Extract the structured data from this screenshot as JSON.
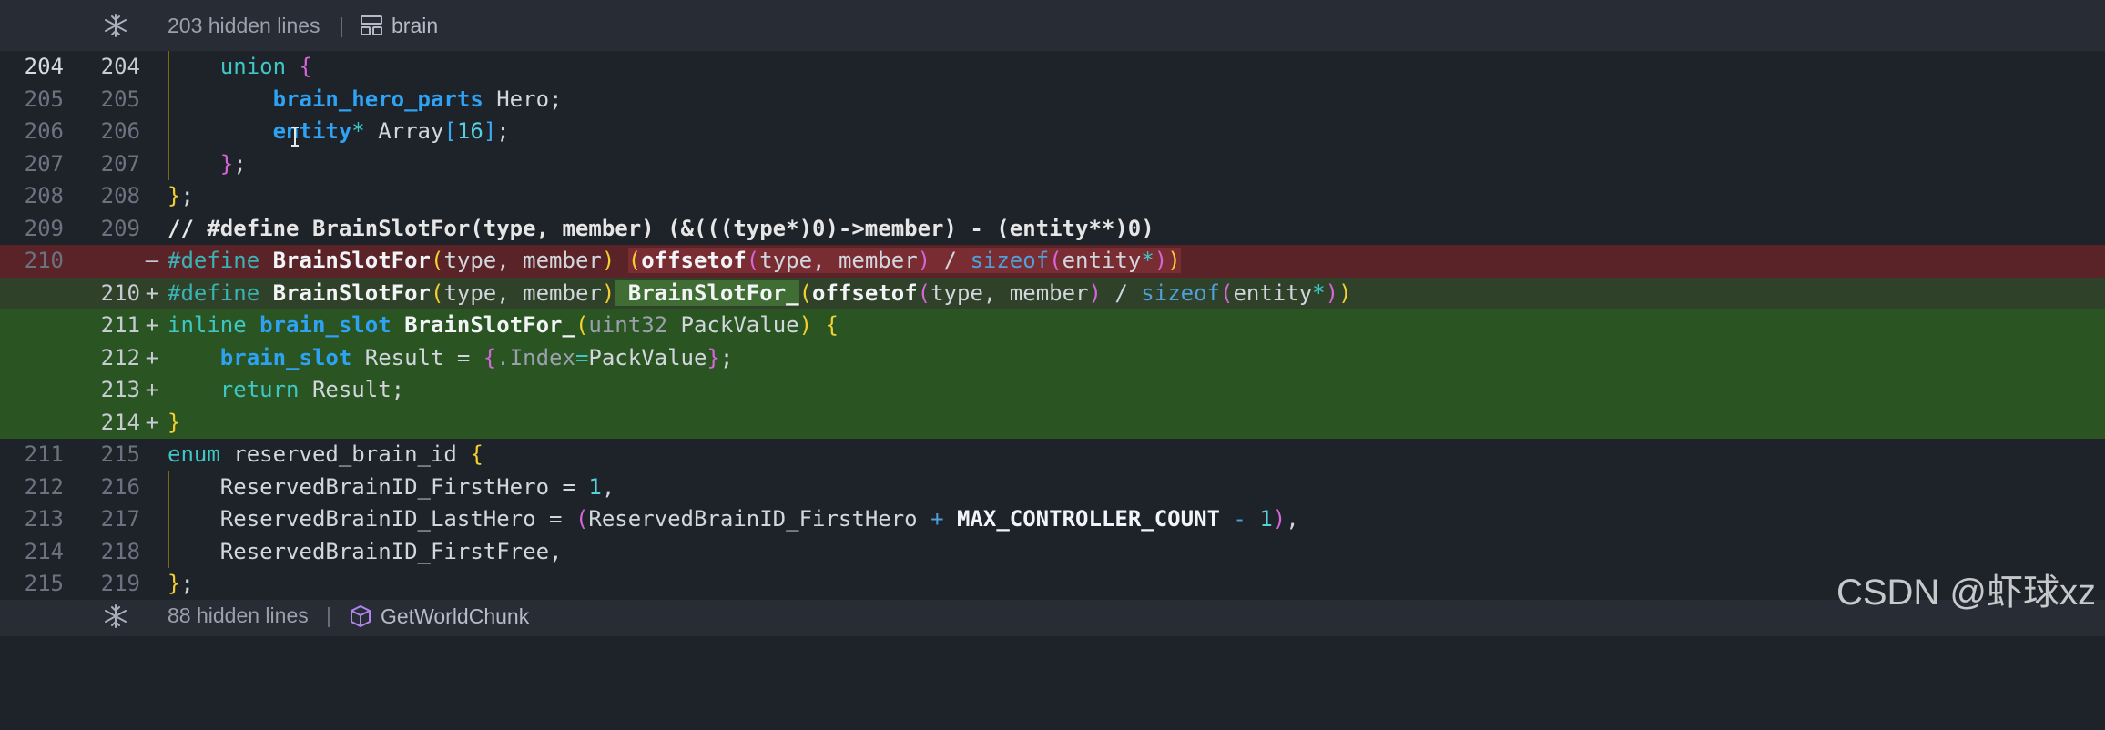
{
  "fold_top": {
    "text": "203 hidden lines",
    "sep": "|",
    "crumb": "brain"
  },
  "fold_bottom": {
    "text": "88 hidden lines",
    "sep": "|",
    "crumb": "GetWorldChunk"
  },
  "lines": [
    {
      "old": "204",
      "new": "204",
      "kind": "ctx",
      "cur": true
    },
    {
      "old": "205",
      "new": "205",
      "kind": "ctx"
    },
    {
      "old": "206",
      "new": "206",
      "kind": "ctx"
    },
    {
      "old": "207",
      "new": "207",
      "kind": "ctx"
    },
    {
      "old": "208",
      "new": "208",
      "kind": "ctx"
    },
    {
      "old": "209",
      "new": "209",
      "kind": "ctx"
    },
    {
      "old": "210",
      "new": "",
      "kind": "del",
      "mark": "—"
    },
    {
      "old": "",
      "new": "210",
      "kind": "mod",
      "mark": "+"
    },
    {
      "old": "",
      "new": "211",
      "kind": "ins",
      "mark": "+"
    },
    {
      "old": "",
      "new": "212",
      "kind": "ins",
      "mark": "+"
    },
    {
      "old": "",
      "new": "213",
      "kind": "ins",
      "mark": "+"
    },
    {
      "old": "",
      "new": "214",
      "kind": "ins",
      "mark": "+"
    },
    {
      "old": "211",
      "new": "215",
      "kind": "ctx"
    },
    {
      "old": "212",
      "new": "216",
      "kind": "ctx"
    },
    {
      "old": "213",
      "new": "217",
      "kind": "ctx"
    },
    {
      "old": "214",
      "new": "218",
      "kind": "ctx"
    },
    {
      "old": "215",
      "new": "219",
      "kind": "ctx"
    }
  ],
  "code": {
    "l0": [
      "    ",
      "union",
      " ",
      "{"
    ],
    "l1": [
      "        ",
      "brain_hero_parts",
      " Hero;"
    ],
    "l2": [
      "        ",
      "entity",
      "*",
      " Array",
      "[",
      "16",
      "]",
      ";"
    ],
    "l3": [
      "    ",
      "}",
      ";"
    ],
    "l4": [
      "}",
      ";"
    ],
    "l5": "// #define BrainSlotFor(type, member) (&(((type*)0)->member) - (entity**)0)",
    "l6": [
      "#define",
      " ",
      "BrainSlotFor",
      "(",
      "type, member",
      ")",
      " ",
      "(",
      "offsetof",
      "(",
      "type, member",
      ")",
      " / ",
      "sizeof",
      "(",
      "entity",
      "*",
      ")",
      ")"
    ],
    "l7": [
      "#define",
      " ",
      "BrainSlotFor",
      "(",
      "type, member",
      ")",
      " ",
      "BrainSlotFor_",
      "(",
      "offsetof",
      "(",
      "type, member",
      ")",
      " / ",
      "sizeof",
      "(",
      "entity",
      "*",
      ")",
      ")"
    ],
    "l8": [
      "inline",
      " ",
      "brain_slot",
      " ",
      "BrainSlotFor_",
      "(",
      "uint32",
      " PackValue",
      ")",
      " ",
      "{"
    ],
    "l9": [
      "    ",
      "brain_slot",
      " Result = ",
      "{",
      ".Index",
      "=",
      "PackValue",
      "}",
      ";"
    ],
    "l10": [
      "    ",
      "return",
      " Result;"
    ],
    "l11": [
      "}"
    ],
    "l12": [
      "enum",
      " reserved_brain_id ",
      "{"
    ],
    "l13": [
      "    ReservedBrainID_FirstHero = ",
      "1",
      ","
    ],
    "l14": [
      "    ReservedBrainID_LastHero = ",
      "(",
      "ReservedBrainID_FirstHero ",
      "+",
      " ",
      "MAX_CONTROLLER_COUNT",
      " ",
      "-",
      " ",
      "1",
      ")",
      ","
    ],
    "l15": [
      "    ReservedBrainID_FirstFree,"
    ],
    "l16": [
      "}",
      ";"
    ]
  },
  "watermark": "CSDN @虾球xz"
}
